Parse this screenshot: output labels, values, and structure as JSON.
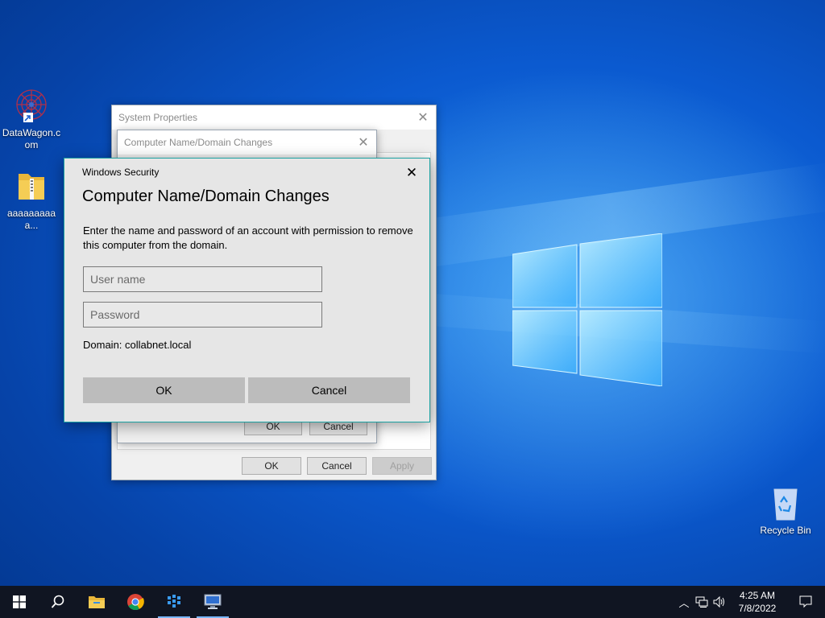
{
  "desktop": {
    "icons": [
      {
        "label": "DataWagon.com",
        "icon": "datawagon-shortcut-icon"
      },
      {
        "label": "aaaaaaaaaa...",
        "icon": "folder-zip-icon"
      },
      {
        "label": "Recycle Bin",
        "icon": "recycle-bin-icon"
      }
    ]
  },
  "system_properties": {
    "title": "System Properties",
    "ok_label": "OK",
    "cancel_label": "Cancel",
    "apply_label": "Apply"
  },
  "name_changes": {
    "title": "Computer Name/Domain Changes",
    "ok_label": "OK",
    "cancel_label": "Cancel"
  },
  "security": {
    "title": "Windows Security",
    "heading": "Computer Name/Domain Changes",
    "description": "Enter the name and password of an account with permission to remove this computer from the domain.",
    "username_placeholder": "User name",
    "password_placeholder": "Password",
    "domain_text": "Domain: collabnet.local",
    "ok_label": "OK",
    "cancel_label": "Cancel"
  },
  "taskbar": {
    "items": [
      "start-icon",
      "search-icon",
      "file-explorer-icon",
      "chrome-icon",
      "datawagon-app-icon",
      "remote-desktop-icon"
    ],
    "time": "4:25 AM",
    "date": "7/8/2022"
  },
  "colors": {
    "desktop_blue": "#0b5ad0",
    "dialog_border": "#1ba1a1",
    "taskbar": "#101522"
  }
}
